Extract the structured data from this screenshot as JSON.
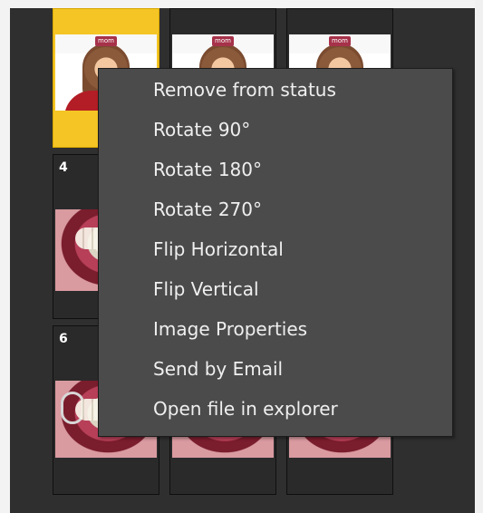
{
  "image_grid": {
    "tiles": [
      {
        "number": "",
        "selected": true,
        "kind": "face"
      },
      {
        "number": "",
        "selected": false,
        "kind": "face"
      },
      {
        "number": "",
        "selected": false,
        "kind": "face"
      },
      {
        "number": "4",
        "selected": false,
        "kind": "mouth"
      },
      {
        "number": "",
        "selected": false,
        "kind": "mouth"
      },
      {
        "number": "",
        "selected": false,
        "kind": "mouth"
      },
      {
        "number": "6",
        "selected": false,
        "kind": "mouth"
      },
      {
        "number": "",
        "selected": false,
        "kind": "mouth"
      },
      {
        "number": "",
        "selected": false,
        "kind": "mouth"
      }
    ]
  },
  "context_menu": {
    "items": [
      {
        "label": "Remove from status"
      },
      {
        "label": "Rotate 90°"
      },
      {
        "label": "Rotate 180°"
      },
      {
        "label": "Rotate 270°"
      },
      {
        "label": "Flip Horizontal"
      },
      {
        "label": "Flip Vertical"
      },
      {
        "label": "Image Properties"
      },
      {
        "label": "Send by Email"
      },
      {
        "label": "Open file in explorer"
      }
    ]
  },
  "colors": {
    "background": "#2f2f2f",
    "selection": "#f4c524",
    "menu_background": "#4b4b4b",
    "menu_text": "#efefef"
  }
}
